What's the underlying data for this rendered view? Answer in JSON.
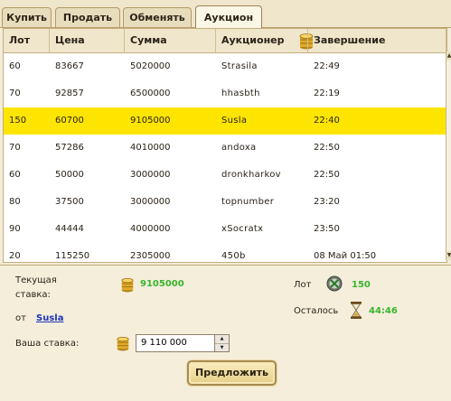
{
  "tabs": [
    {
      "label": "Купить"
    },
    {
      "label": "Продать"
    },
    {
      "label": "Обменять"
    },
    {
      "label": "Аукцион"
    }
  ],
  "table": {
    "headers": [
      "Лот",
      "Цена",
      "Сумма",
      "Аукционер",
      "Завершение"
    ],
    "rows": [
      {
        "lot": "60",
        "price": "83667",
        "sum": "5020000",
        "auctioneer": "Strasila",
        "end": "22:49"
      },
      {
        "lot": "70",
        "price": "92857",
        "sum": "6500000",
        "auctioneer": "hhasbth",
        "end": "22:19"
      },
      {
        "lot": "150",
        "price": "60700",
        "sum": "9105000",
        "auctioneer": "Susla",
        "end": "22:40",
        "selected": true
      },
      {
        "lot": "70",
        "price": "57286",
        "sum": "4010000",
        "auctioneer": "andoxa",
        "end": "22:50"
      },
      {
        "lot": "60",
        "price": "50000",
        "sum": "3000000",
        "auctioneer": "dronkharkov",
        "end": "22:50"
      },
      {
        "lot": "80",
        "price": "37500",
        "sum": "3000000",
        "auctioneer": "topnumber",
        "end": "23:20"
      },
      {
        "lot": "90",
        "price": "44444",
        "sum": "4000000",
        "auctioneer": "xSocratx",
        "end": "23:50"
      },
      {
        "lot": "20",
        "price": "115250",
        "sum": "2305000",
        "auctioneer": "450b",
        "end": "08 Май 01:50"
      }
    ]
  },
  "details": {
    "current_bid_label_1": "Текущая",
    "current_bid_label_2": "ставка:",
    "current_bid_value": "9105000",
    "from_label": "от",
    "from_user": "Susla",
    "lot_label": "Лот",
    "lot_value": "150",
    "remaining_label": "Осталось",
    "remaining_value": "44:46",
    "your_bid_label": "Ваша ставка:",
    "your_bid_value": "9 110 000"
  },
  "submit_label": "Предложить",
  "icons": {
    "coin": "coin-stack-icon",
    "lot": "lot-x-icon",
    "timer": "hourglass-icon",
    "scroll_up": "arrow-up-icon",
    "scroll_down": "arrow-down-icon",
    "spin_up": "spin-up-icon",
    "spin_down": "spin-down-icon"
  },
  "colors": {
    "selected_row": "#fde500",
    "accent_green": "#38b52d",
    "link_blue": "#1a35b8"
  }
}
